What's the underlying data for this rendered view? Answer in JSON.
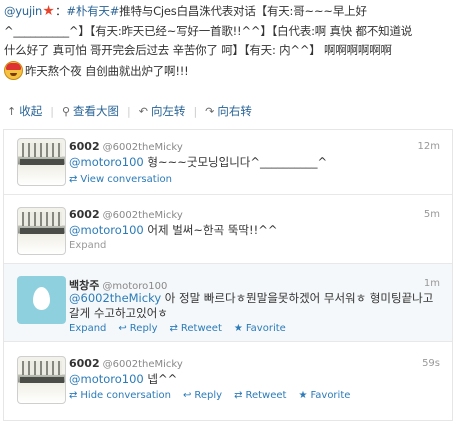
{
  "post": {
    "username": "@yujin",
    "colon": "：",
    "tag": "#朴有天#",
    "line1_rest": "推特与Cjes白昌洙代表对话【有天:哥~~~早上好",
    "line2": "^__________^】【有天:昨天已经~写好一首歌!!^^】【白代表:啊 真快 都不知道说",
    "line3": "什么好了 真可怕 哥开完会后过去 辛苦你了 呵】【有天: 内^^】 啊啊啊啊啊啊",
    "line4": "昨天熬个夜 自创曲就出炉了啊!!!"
  },
  "toolbar": {
    "collapse": "收起",
    "original": "查看大图",
    "rotate_left": "向左转",
    "rotate_right": "向右转"
  },
  "tweets": [
    {
      "name": "6002",
      "handle": "@6002theMicky",
      "time": "12m",
      "mention": "@motoro100",
      "text": " 형~~~굿모닝입니다^__________^",
      "actions": [
        {
          "icon": "conversation-icon",
          "label": "View conversation"
        }
      ]
    },
    {
      "name": "6002",
      "handle": "@6002theMicky",
      "time": "5m",
      "mention": "@motoro100",
      "text": " 어제 벌써~한곡 뚝딱!!^^",
      "expand": "Expand"
    },
    {
      "name": "백창주",
      "handle": "@motoro100",
      "time": "1m",
      "mention": "@6002theMicky",
      "text": " 아 정말 빠르다ㅎ뭔말을못하겠어 무서워ㅎ 형미팅끝나고 갈게 수고하고있어ㅎ",
      "actions": [
        {
          "icon": "",
          "label": "Expand"
        },
        {
          "icon": "reply-icon",
          "label": "Reply"
        },
        {
          "icon": "retweet-icon",
          "label": "Retweet"
        },
        {
          "icon": "favorite-icon",
          "label": "Favorite"
        }
      ]
    },
    {
      "name": "6002",
      "handle": "@6002theMicky",
      "time": "59s",
      "mention": "@motoro100",
      "text": " 넵^^",
      "actions": [
        {
          "icon": "conversation-icon",
          "label": "Hide conversation"
        },
        {
          "icon": "reply-icon",
          "label": "Reply"
        },
        {
          "icon": "retweet-icon",
          "label": "Retweet"
        },
        {
          "icon": "favorite-icon",
          "label": "Favorite"
        }
      ]
    }
  ]
}
